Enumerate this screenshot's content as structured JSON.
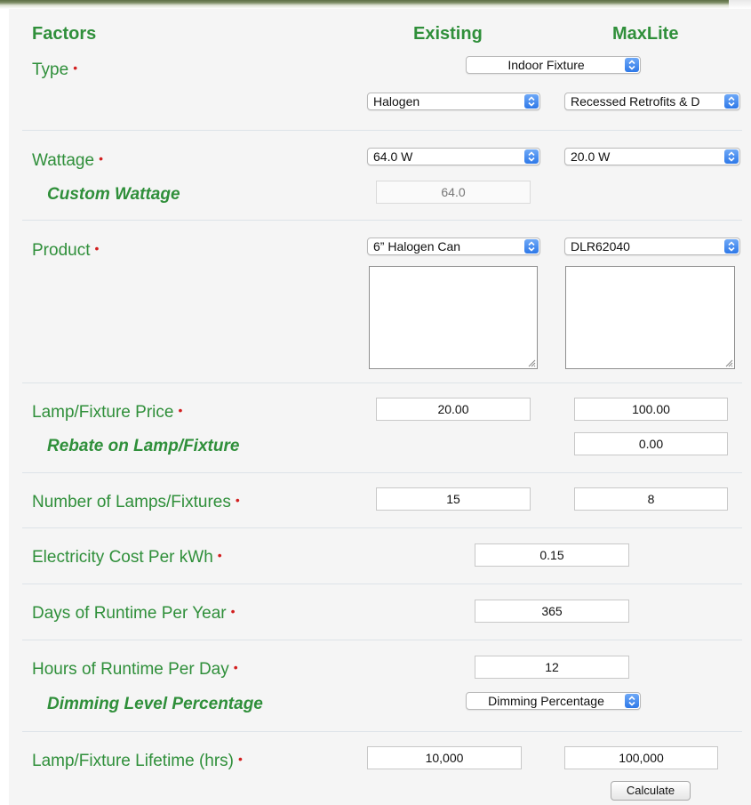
{
  "header": {
    "factors": "Factors",
    "existing": "Existing",
    "maxlite": "MaxLite"
  },
  "required_mark": "•",
  "type": {
    "label": "Type",
    "category": "Indoor Fixture",
    "existing": "Halogen",
    "maxlite": "Recessed Retrofits & D"
  },
  "wattage": {
    "label": "Wattage",
    "existing": "64.0 W",
    "maxlite": "20.0 W",
    "custom_label": "Custom Wattage",
    "custom_value": "64.0"
  },
  "product": {
    "label": "Product",
    "existing": "6” Halogen Can",
    "maxlite": "DLR62040"
  },
  "price": {
    "label": "Lamp/Fixture Price",
    "existing": "20.00",
    "maxlite": "100.00",
    "rebate_label": "Rebate on Lamp/Fixture",
    "rebate_value": "0.00"
  },
  "count": {
    "label": "Number of Lamps/Fixtures",
    "existing": "15",
    "maxlite": "8"
  },
  "electricity": {
    "label": "Electricity Cost Per kWh",
    "value": "0.15"
  },
  "days": {
    "label": "Days of Runtime Per Year",
    "value": "365"
  },
  "hours": {
    "label": "Hours of Runtime Per Day",
    "value": "12",
    "dimming_label": "Dimming Level Percentage",
    "dimming_value": "Dimming Percentage"
  },
  "lifetime": {
    "label": "Lamp/Fixture Lifetime (hrs)",
    "existing": "10,000",
    "maxlite": "100,000"
  },
  "calculate_label": "Calculate",
  "icons": {
    "select_caret": "up-down-chevron-icon",
    "resize_grip": "resize-grip-icon"
  },
  "colors": {
    "label_green": "#2f8f3a",
    "required_red": "#d21f1f",
    "select_blue": "#2e78e8",
    "panel_bg": "#f5f5f5"
  }
}
